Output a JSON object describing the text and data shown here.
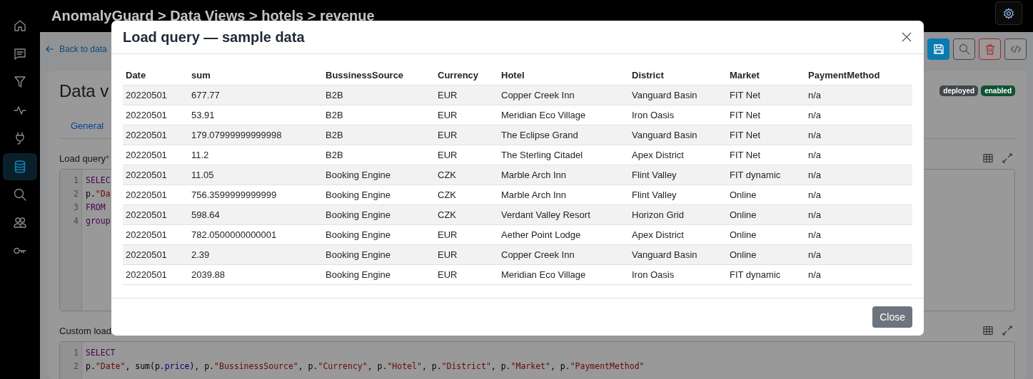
{
  "sidebar": {
    "items": [
      {
        "selected": false
      },
      {
        "selected": false
      },
      {
        "selected": false
      },
      {
        "selected": false
      },
      {
        "selected": false
      },
      {
        "selected": true
      },
      {
        "selected": false
      },
      {
        "selected": false
      },
      {
        "selected": false
      }
    ]
  },
  "header": {
    "breadcrumb": "AnomalyGuard > Data Views > hotels > revenue"
  },
  "page": {
    "back_link": "Back to data",
    "title": "Data v",
    "badges": [
      {
        "label": "deployed",
        "color": "#41464b"
      },
      {
        "label": "enabled",
        "color": "#0f5132"
      }
    ],
    "tabs": [
      {
        "label": "General",
        "selected": true
      }
    ],
    "load_query": {
      "label": "Load query",
      "required_mark": "*",
      "lines": [
        {
          "number": "1",
          "tokens": [
            {
              "text": "SELEC",
              "kind": "keyword"
            }
          ]
        },
        {
          "number": "2",
          "tokens": [
            {
              "text": "p.",
              "kind": "plain"
            },
            {
              "text": "\"Da",
              "kind": "string"
            }
          ]
        },
        {
          "number": "3",
          "tokens": [
            {
              "text": "FROM",
              "kind": "keyword"
            }
          ]
        },
        {
          "number": "4",
          "tokens": [
            {
              "text": "group",
              "kind": "keyword"
            }
          ]
        }
      ]
    },
    "custom_query": {
      "label": "Custom load",
      "lines": [
        {
          "number": "1",
          "tokens": [
            {
              "text": "SELECT",
              "kind": "keyword"
            }
          ]
        },
        {
          "number": "2",
          "tokens": [
            {
              "text": "p.",
              "kind": "plain"
            },
            {
              "text": "\"Date\"",
              "kind": "string"
            },
            {
              "text": ", sum(p.",
              "kind": "plain"
            },
            {
              "text": "price",
              "kind": "property"
            },
            {
              "text": "), p.",
              "kind": "plain"
            },
            {
              "text": "\"BussinessSource\"",
              "kind": "string"
            },
            {
              "text": ", p.",
              "kind": "plain"
            },
            {
              "text": "\"Currency\"",
              "kind": "string"
            },
            {
              "text": ", p.",
              "kind": "plain"
            },
            {
              "text": "\"Hotel\"",
              "kind": "string"
            },
            {
              "text": ", p.",
              "kind": "plain"
            },
            {
              "text": "\"District\"",
              "kind": "string"
            },
            {
              "text": ", p.",
              "kind": "plain"
            },
            {
              "text": "\"Market\"",
              "kind": "string"
            },
            {
              "text": ", p.",
              "kind": "plain"
            },
            {
              "text": "\"PaymentMethod\"",
              "kind": "string"
            }
          ]
        }
      ]
    }
  },
  "modal": {
    "title": "Load query — sample data",
    "columns": [
      "Date",
      "sum",
      "BussinessSource",
      "Currency",
      "Hotel",
      "District",
      "Market",
      "PaymentMethod"
    ],
    "rows": [
      [
        "20220501",
        "677.77",
        "B2B",
        "EUR",
        "Copper Creek Inn",
        "Vanguard Basin",
        "FIT Net",
        "n/a"
      ],
      [
        "20220501",
        "53.91",
        "B2B",
        "EUR",
        "Meridian Eco Village",
        "Iron Oasis",
        "FIT Net",
        "n/a"
      ],
      [
        "20220501",
        "179.07999999999998",
        "B2B",
        "EUR",
        "The Eclipse Grand",
        "Vanguard Basin",
        "FIT Net",
        "n/a"
      ],
      [
        "20220501",
        "11.2",
        "B2B",
        "EUR",
        "The Sterling Citadel",
        "Apex District",
        "FIT Net",
        "n/a"
      ],
      [
        "20220501",
        "11.05",
        "Booking Engine",
        "CZK",
        "Marble Arch Inn",
        "Flint Valley",
        "FIT dynamic",
        "n/a"
      ],
      [
        "20220501",
        "756.3599999999999",
        "Booking Engine",
        "CZK",
        "Marble Arch Inn",
        "Flint Valley",
        "Online",
        "n/a"
      ],
      [
        "20220501",
        "598.64",
        "Booking Engine",
        "CZK",
        "Verdant Valley Resort",
        "Horizon Grid",
        "Online",
        "n/a"
      ],
      [
        "20220501",
        "782.0500000000001",
        "Booking Engine",
        "EUR",
        "Aether Point Lodge",
        "Apex District",
        "Online",
        "n/a"
      ],
      [
        "20220501",
        "2.39",
        "Booking Engine",
        "EUR",
        "Copper Creek Inn",
        "Vanguard Basin",
        "Online",
        "n/a"
      ],
      [
        "20220501",
        "2039.88",
        "Booking Engine",
        "EUR",
        "Meridian Eco Village",
        "Iron Oasis",
        "FIT dynamic",
        "n/a"
      ]
    ],
    "close_button": "Close"
  }
}
